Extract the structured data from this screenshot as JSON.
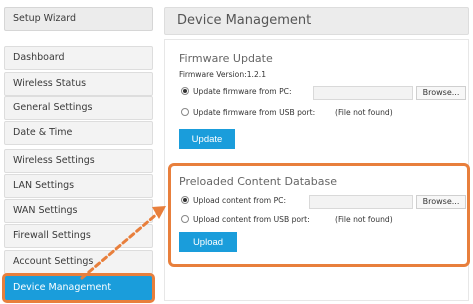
{
  "sidebar": {
    "items": [
      {
        "label": "Setup Wizard"
      },
      {
        "label": "Dashboard"
      },
      {
        "label": "Wireless Status"
      },
      {
        "label": "General Settings"
      },
      {
        "label": "Date & Time"
      },
      {
        "label": "Wireless Settings"
      },
      {
        "label": "LAN Settings"
      },
      {
        "label": "WAN Settings"
      },
      {
        "label": "Firewall Settings"
      },
      {
        "label": "Account Settings"
      },
      {
        "label": "Device Management"
      }
    ]
  },
  "main": {
    "title": "Device Management",
    "firmware": {
      "title": "Firmware Update",
      "version": "Firmware Version:1.2.1",
      "option_pc": "Update firmware from PC:",
      "option_usb": "Update firmware from USB port:",
      "usb_status": "(File not found)",
      "browse_label": "Browse...",
      "update_label": "Update"
    },
    "preloaded": {
      "title": "Preloaded Content Database",
      "option_pc": "Upload content from PC:",
      "option_usb": "Upload content from USB port:",
      "usb_status": "(File not found)",
      "browse_label": "Browse...",
      "upload_label": "Upload"
    }
  },
  "colors": {
    "accent_blue": "#1a9ddb",
    "highlight_orange": "#e87f3c",
    "sidebar_bg": "#f3f3f3"
  },
  "icons": {
    "radio_checked": "radio-checked-icon",
    "radio_unchecked": "radio-unchecked-icon",
    "arrow": "dashed-arrow-icon"
  }
}
